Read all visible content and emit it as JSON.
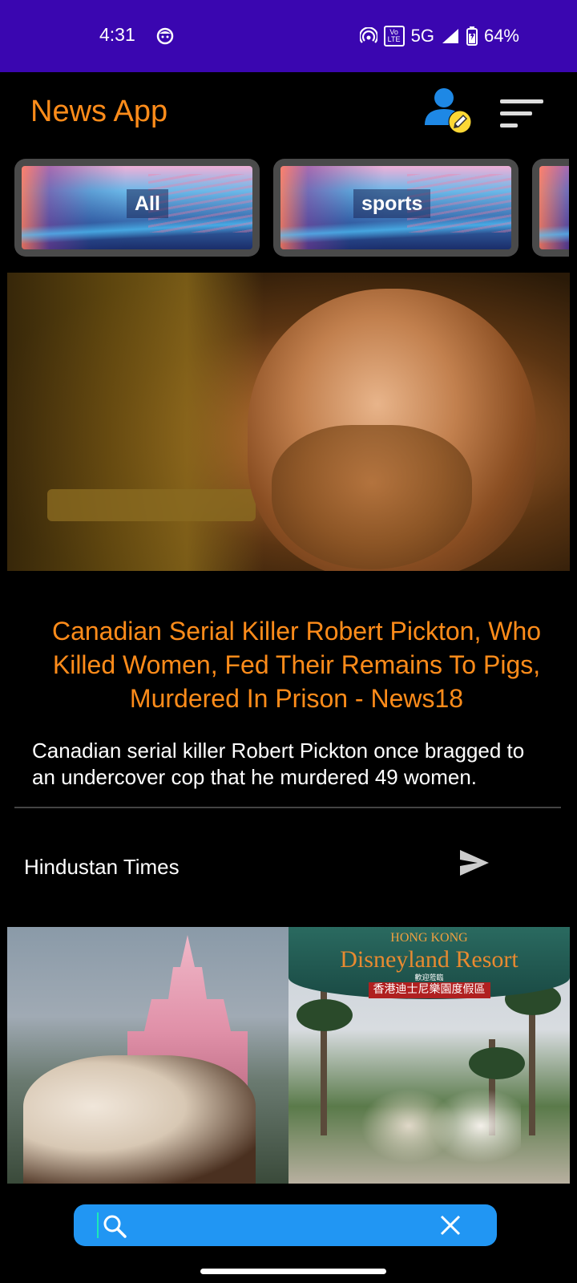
{
  "status_bar": {
    "time": "4:31",
    "network": "5G",
    "battery": "64%",
    "volte_label": "Vo LTE"
  },
  "header": {
    "title": "News App",
    "profile_icon": "user-edit-icon",
    "menu_icon": "sort-menu-icon"
  },
  "categories": [
    {
      "label": "All"
    },
    {
      "label": "sports"
    },
    {
      "label": ""
    }
  ],
  "article": {
    "headline": "Canadian Serial Killer Robert Pickton, Who Killed Women, Fed Their Remains To Pigs, Murdered In Prison - News18",
    "description": "Canadian serial killer Robert Pickton once bragged to an undercover cop that he murdered 49 women.",
    "source": "Hindustan Times",
    "share_icon": "send-icon"
  },
  "second_article_image": {
    "sign_line1": "HONG KONG",
    "sign_line2": "Disneyland Resort",
    "sign_line3": "香港迪士尼樂園度假區",
    "sign_line_small": "歡迎蒞臨"
  },
  "search": {
    "value": "",
    "placeholder": "",
    "search_icon": "search-icon",
    "clear_icon": "close-icon"
  },
  "colors": {
    "status_bar": "#3a06b0",
    "accent": "#ff8c1a",
    "search_bar": "#2196f3",
    "background": "#000000"
  }
}
